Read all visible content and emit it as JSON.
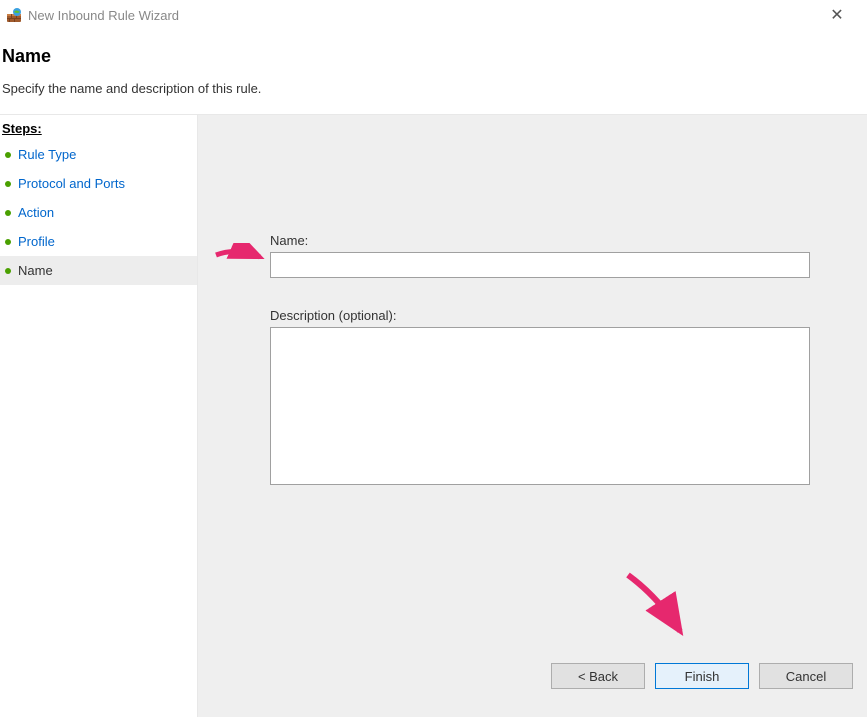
{
  "window": {
    "title": "New Inbound Rule Wizard"
  },
  "header": {
    "title": "Name",
    "subtitle": "Specify the name and description of this rule."
  },
  "sidebar": {
    "heading": "Steps:",
    "items": [
      {
        "label": "Rule Type"
      },
      {
        "label": "Protocol and Ports"
      },
      {
        "label": "Action"
      },
      {
        "label": "Profile"
      },
      {
        "label": "Name"
      }
    ]
  },
  "form": {
    "name_label": "Name:",
    "name_value": "",
    "desc_label": "Description (optional):",
    "desc_value": ""
  },
  "buttons": {
    "back": "< Back",
    "finish": "Finish",
    "cancel": "Cancel"
  }
}
